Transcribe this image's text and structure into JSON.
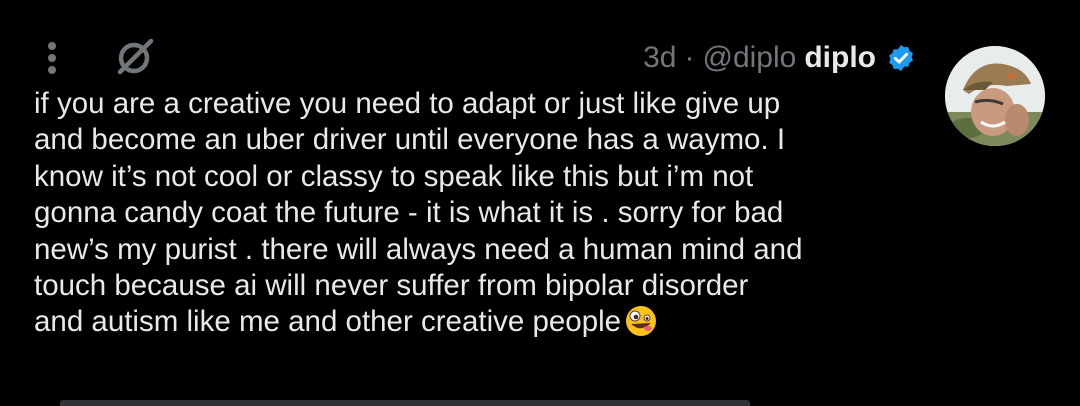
{
  "tweet": {
    "time": "3d",
    "separator": "·",
    "handle": "@diplo",
    "display_name": "diplo",
    "text_lines": [
      "if you are a creative you need to adapt or just like give up",
      "and become an uber driver until everyone has a waymo. I",
      "know it’s not cool or classy to speak like this but i’m not",
      "gonna candy coat the future - it is what it is . sorry for bad",
      "new’s my purist . there will always need a human mind and",
      "touch because ai will never suffer from bipolar disorder",
      "and autism like me and other creative people"
    ]
  },
  "icons": {
    "more": "more-vertical-icon",
    "grok": "grok-icon",
    "verified": "verified-badge-icon",
    "emoji": "zany-face-emoji"
  },
  "colors": {
    "background": "#000000",
    "text": "#e7e9ea",
    "muted": "#71767b",
    "verified": "#1d9bf0"
  }
}
